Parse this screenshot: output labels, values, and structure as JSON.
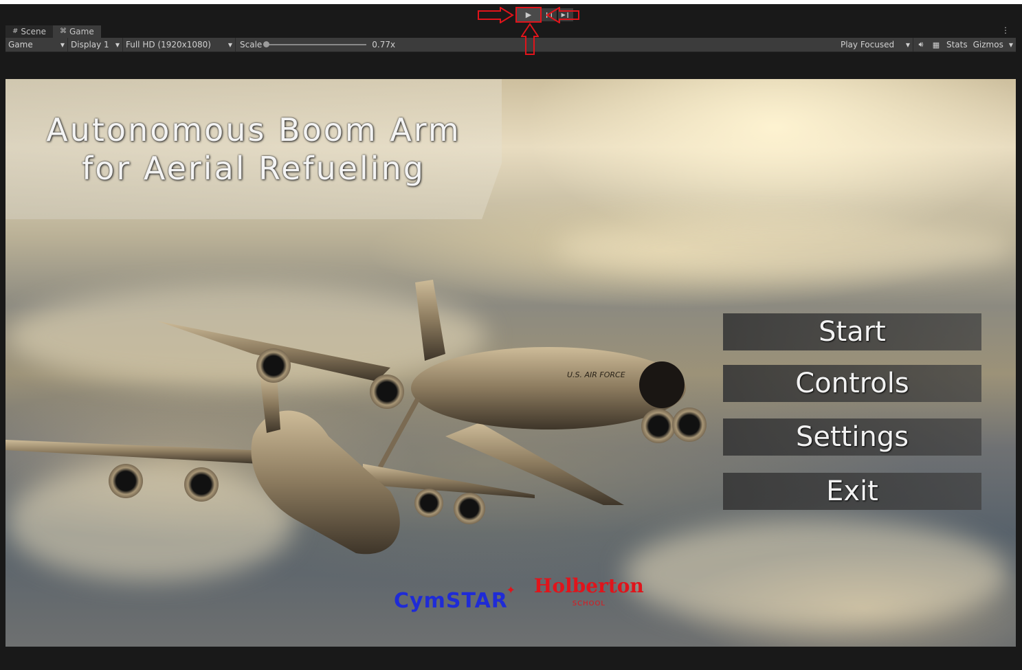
{
  "playbar": {
    "play_glyph": "▶",
    "pause_glyph": "❙❙",
    "step_glyph": "▶❙"
  },
  "tabs": [
    {
      "label": "Scene",
      "icon": "grid-icon"
    },
    {
      "label": "Game",
      "icon": "gamepad-icon"
    }
  ],
  "toolbar": {
    "view_dropdown": "Game",
    "display_dropdown": "Display 1",
    "resolution_dropdown": "Full HD (1920x1080)",
    "scale_label": "Scale",
    "scale_value": "0.77x",
    "play_mode_dropdown": "Play Focused",
    "stats_label": "Stats",
    "gizmos_label": "Gizmos"
  },
  "game": {
    "title_line1": "Autonomous Boom Arm",
    "title_line2": "for Aerial Refueling",
    "menu": [
      "Start",
      "Controls",
      "Settings",
      "Exit"
    ],
    "aircraft_text": "U.S. AIR FORCE",
    "logo_cymstar": "CymSTAR",
    "logo_holberton": "Holberton",
    "logo_holberton_sub": "SCHOOL"
  },
  "annotation_color": "#e0141b"
}
